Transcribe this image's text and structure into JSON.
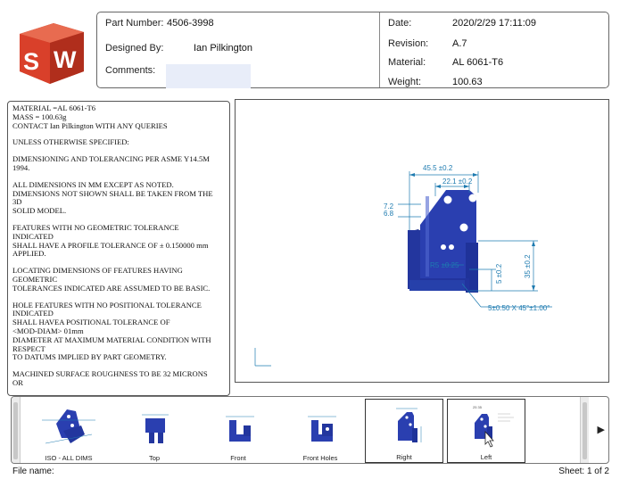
{
  "header": {
    "part_number_label": "Part Number:",
    "part_number": "4506-3998",
    "designed_by_label": "Designed By:",
    "designed_by": "Ian Pilkington",
    "comments_label": "Comments:",
    "comments": "",
    "date_label": "Date:",
    "date": "2020/2/29 17:11:09",
    "revision_label": "Revision:",
    "revision": "A.7",
    "material_label": "Material:",
    "material": "AL 6061-T6",
    "weight_label": "Weight:",
    "weight": "100.63"
  },
  "logo": {
    "text": "SW",
    "color": "#d9402a"
  },
  "notes": [
    "MATERIAL =AL 6061-T6",
    "MASS = 100.63g",
    "CONTACT Ian Pilkington WITH ANY QUERIES",
    "UNLESS OTHERWISE SPECIFIED:",
    "DIMENSIONING AND TOLERANCING PER ASME Y14.5M",
    "1994.",
    "ALL DIMENSIONS IN MM EXCEPT AS NOTED.",
    "DIMENSIONS NOT SHOWN SHALL BE TAKEN FROM THE",
    "3D",
    "SOLID MODEL.",
    "FEATURES WITH NO GEOMETRIC TOLERANCE",
    "INDICATED",
    "SHALL HAVE A PROFILE TOLERANCE OF ± 0.150000 mm",
    "APPLIED.",
    "LOCATING DIMENSIONS OF FEATURES HAVING",
    "GEOMETRIC",
    "TOLERANCES INDICATED ARE ASSUMED TO BE BASIC.",
    "HOLE FEATURES WITH NO POSITIONAL TOLERANCE",
    "INDICATED",
    "SHALL HAVEA POSITIONAL TOLERANCE OF",
    "<MOD-DIAM> 01mm",
    "DIAMETER AT MAXIMUM MATERIAL CONDITION WITH",
    "RESPECT",
    "TO DATUMS IMPLIED BY PART GEOMETRY.",
    "MACHINED SURFACE ROUGHNESS TO BE 32 MICRONS",
    "OR"
  ],
  "notes_gap_before": [
    3,
    4,
    6,
    10,
    14,
    17,
    24
  ],
  "drawing": {
    "dims": {
      "width_overall": "45.5 ±0.2",
      "width_inner": "22.1 ±0.2",
      "left_upper": "7.2",
      "left_lower": "6.8",
      "radius": "R5 ±0.25",
      "height_small": "5 ±0.2",
      "height_total": "35 ±0.2",
      "chamfer": "5±0.50  X 45°±1.00°"
    },
    "part_color": "#2a3fb0",
    "dim_color": "#1e7bb0"
  },
  "thumbnails": [
    {
      "label": "ISO - ALL DIMS",
      "selected": false
    },
    {
      "label": "Top",
      "selected": false
    },
    {
      "label": "Front",
      "selected": false
    },
    {
      "label": "Front Holes",
      "selected": false
    },
    {
      "label": "Right",
      "selected": true
    },
    {
      "label": "Left",
      "selected": true
    }
  ],
  "thumb_left_note": "25 35",
  "footer": {
    "file_name_label": "File name:",
    "file_name": "",
    "sheet": "Sheet: 1 of 2"
  }
}
